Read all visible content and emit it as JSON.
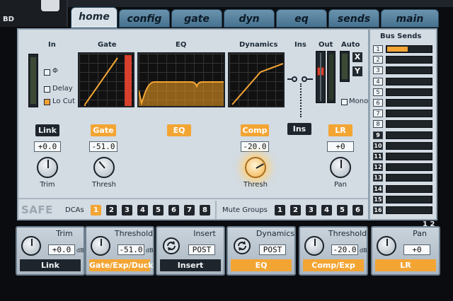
{
  "channel": {
    "name": "BD"
  },
  "tabs": [
    {
      "label": "home",
      "active": true
    },
    {
      "label": "config",
      "active": false
    },
    {
      "label": "gate",
      "active": false
    },
    {
      "label": "dyn",
      "active": false
    },
    {
      "label": "eq",
      "active": false
    },
    {
      "label": "sends",
      "active": false
    },
    {
      "label": "main",
      "active": false
    }
  ],
  "sections": {
    "in": "In",
    "gate": "Gate",
    "eq": "EQ",
    "dynamics": "Dynamics",
    "ins": "Ins",
    "out": "Out",
    "auto": "Auto"
  },
  "input_options": {
    "phase": {
      "label": "Φ",
      "checked": false
    },
    "delay": {
      "label": "Delay",
      "checked": false
    },
    "locut": {
      "label": "Lo Cut",
      "checked": true
    }
  },
  "auto": {
    "x": "X",
    "y": "Y",
    "mono_label": "Mono",
    "mono_checked": false
  },
  "controls": {
    "link": {
      "label": "Link",
      "value": "+0.0",
      "knob_label": "Trim"
    },
    "gate": {
      "label": "Gate",
      "value": "-51.0",
      "knob_label": "Thresh"
    },
    "eq": {
      "label": "EQ"
    },
    "comp": {
      "label": "Comp",
      "value": "-20.0",
      "knob_label": "Thresh"
    },
    "ins": {
      "label": "Ins"
    },
    "lr": {
      "label": "LR",
      "value": "+0",
      "knob_label": "Pan"
    }
  },
  "footer": {
    "safe": "SAFE",
    "dcas_label": "DCAs",
    "dcas": [
      {
        "n": "1",
        "on": true
      },
      {
        "n": "2",
        "on": false
      },
      {
        "n": "3",
        "on": false
      },
      {
        "n": "4",
        "on": false
      },
      {
        "n": "5",
        "on": false
      },
      {
        "n": "6",
        "on": false
      },
      {
        "n": "7",
        "on": false
      },
      {
        "n": "8",
        "on": false
      }
    ],
    "mute_groups_label": "Mute Groups",
    "mute_groups": [
      "1",
      "2",
      "3",
      "4",
      "5",
      "6"
    ]
  },
  "bus_sends": {
    "title": "Bus Sends",
    "buses": [
      {
        "n": "1",
        "level": 0.45,
        "dark": false
      },
      {
        "n": "2",
        "level": 0,
        "dark": false
      },
      {
        "n": "3",
        "level": 0,
        "dark": false
      },
      {
        "n": "4",
        "level": 0,
        "dark": false
      },
      {
        "n": "5",
        "level": 0,
        "dark": false
      },
      {
        "n": "6",
        "level": 0,
        "dark": false
      },
      {
        "n": "7",
        "level": 0,
        "dark": false
      },
      {
        "n": "8",
        "level": 0,
        "dark": false
      },
      {
        "n": "9",
        "level": 0,
        "dark": true
      },
      {
        "n": "10",
        "level": 0,
        "dark": true
      },
      {
        "n": "11",
        "level": 0,
        "dark": true
      },
      {
        "n": "12",
        "level": 0,
        "dark": true
      },
      {
        "n": "13",
        "level": 0,
        "dark": true
      },
      {
        "n": "14",
        "level": 0,
        "dark": true
      },
      {
        "n": "15",
        "level": 0,
        "dark": true
      },
      {
        "n": "16",
        "level": 0,
        "dark": true
      }
    ]
  },
  "page_badge": "1 2",
  "encoders": [
    {
      "title": "Trim",
      "value": "+0.0",
      "unit": "dB",
      "footer": "Link",
      "footer_style": "dark",
      "type": "knob"
    },
    {
      "title": "Threshold",
      "value": "-51.0",
      "unit": "dB",
      "footer": "Gate/Exp/Duck",
      "footer_style": "orange",
      "type": "knob"
    },
    {
      "title": "Insert",
      "value": "POST",
      "unit": "",
      "footer": "Insert",
      "footer_style": "dark",
      "type": "cycle"
    },
    {
      "title": "Dynamics",
      "value": "POST",
      "unit": "",
      "footer": "EQ",
      "footer_style": "orange",
      "type": "cycle"
    },
    {
      "title": "Threshold",
      "value": "-20.0",
      "unit": "dB",
      "footer": "Comp/Exp",
      "footer_style": "orange",
      "type": "knob"
    },
    {
      "title": "Pan",
      "value": "+0",
      "unit": "",
      "footer": "LR",
      "footer_style": "orange",
      "type": "knob"
    }
  ],
  "colors": {
    "accent": "#f3a534",
    "tab": "#5a86a2",
    "panel": "#d3dbe3",
    "dark": "#1e252c"
  }
}
